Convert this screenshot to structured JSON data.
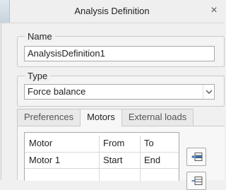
{
  "window": {
    "title": "Analysis Definition",
    "close_glyph": "×"
  },
  "name_group": {
    "label": "Name",
    "value": "AnalysisDefinition1"
  },
  "type_group": {
    "label": "Type",
    "selected": "Force balance"
  },
  "tabs": [
    {
      "label": "Preferences",
      "active": false
    },
    {
      "label": "Motors",
      "active": true
    },
    {
      "label": "External loads",
      "active": false
    }
  ],
  "motors_table": {
    "headers": [
      "Motor",
      "From",
      "To"
    ],
    "rows": [
      [
        "Motor 1",
        "Start",
        "End"
      ]
    ]
  },
  "icons": {
    "add_row": "add-row-icon",
    "remove_row": "remove-row-icon"
  },
  "colors": {
    "accent": "#2f6fbf"
  }
}
